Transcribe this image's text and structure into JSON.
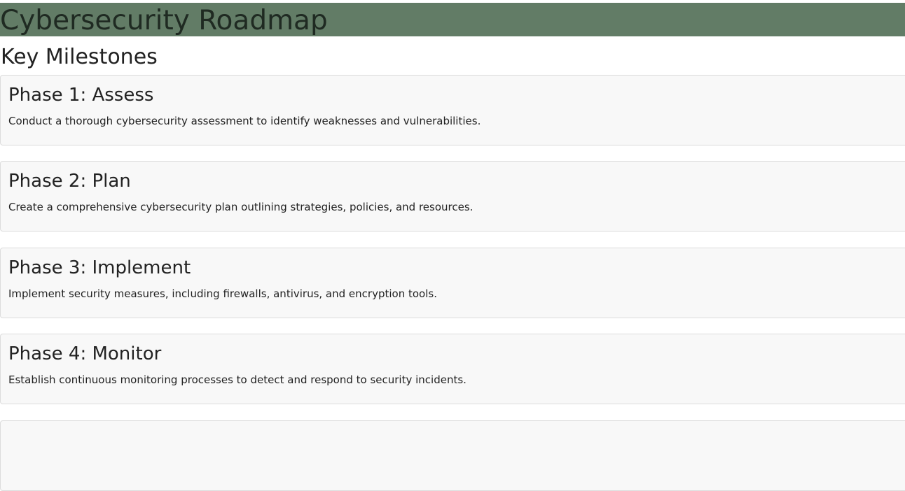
{
  "header": {
    "title": "Cybersecurity Roadmap",
    "bg_color": "#627c66"
  },
  "section": {
    "title": "Key Milestones"
  },
  "milestones": [
    {
      "title": "Phase 1: Assess",
      "description": "Conduct a thorough cybersecurity assessment to identify weaknesses and vulnerabilities."
    },
    {
      "title": "Phase 2: Plan",
      "description": "Create a comprehensive cybersecurity plan outlining strategies, policies, and resources."
    },
    {
      "title": "Phase 3: Implement",
      "description": "Implement security measures, including firewalls, antivirus, and encryption tools."
    },
    {
      "title": "Phase 4: Monitor",
      "description": "Establish continuous monitoring processes to detect and respond to security incidents."
    }
  ]
}
